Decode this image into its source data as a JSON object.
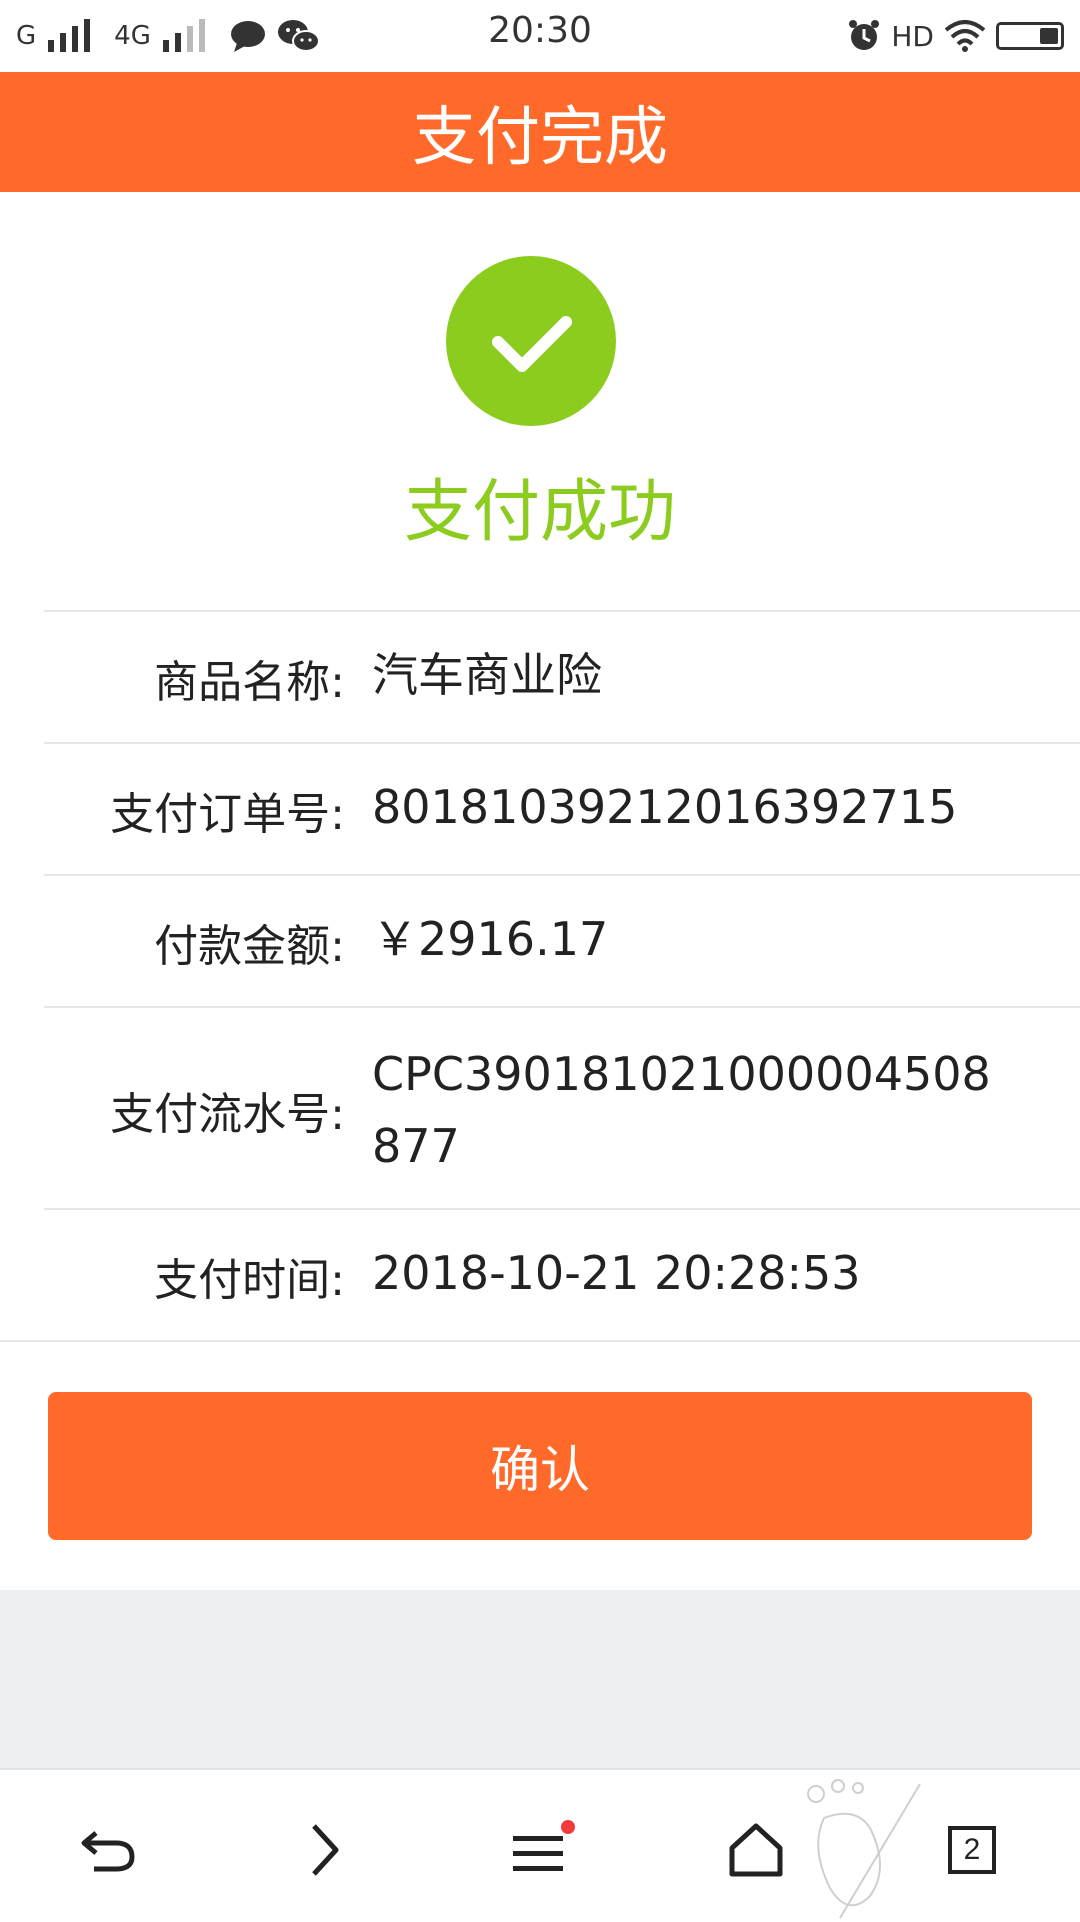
{
  "status_bar": {
    "carrier1": "G",
    "carrier2": "4G",
    "time": "20:30",
    "hd": "HD"
  },
  "header": {
    "title": "支付完成"
  },
  "result": {
    "text": "支付成功",
    "icon": "check-circle-icon",
    "color": "#8ccc1e"
  },
  "info": {
    "product_label": "商品名称:",
    "product_value": "汽车商业险",
    "order_label": "支付订单号:",
    "order_value": "80181039212016392715",
    "amount_label": "付款金额:",
    "amount_value": "￥2916.17",
    "serial_label": "支付流水号:",
    "serial_value": "CPC390181021000004508877",
    "time_label": "支付时间:",
    "time_value": "2018-10-21 20:28:53"
  },
  "actions": {
    "confirm_label": "确认"
  },
  "bottom_nav": {
    "tab_count": "2"
  },
  "colors": {
    "accent": "#ff6a2a",
    "success": "#8ccc1e",
    "gray_bg": "#eeeff2"
  }
}
